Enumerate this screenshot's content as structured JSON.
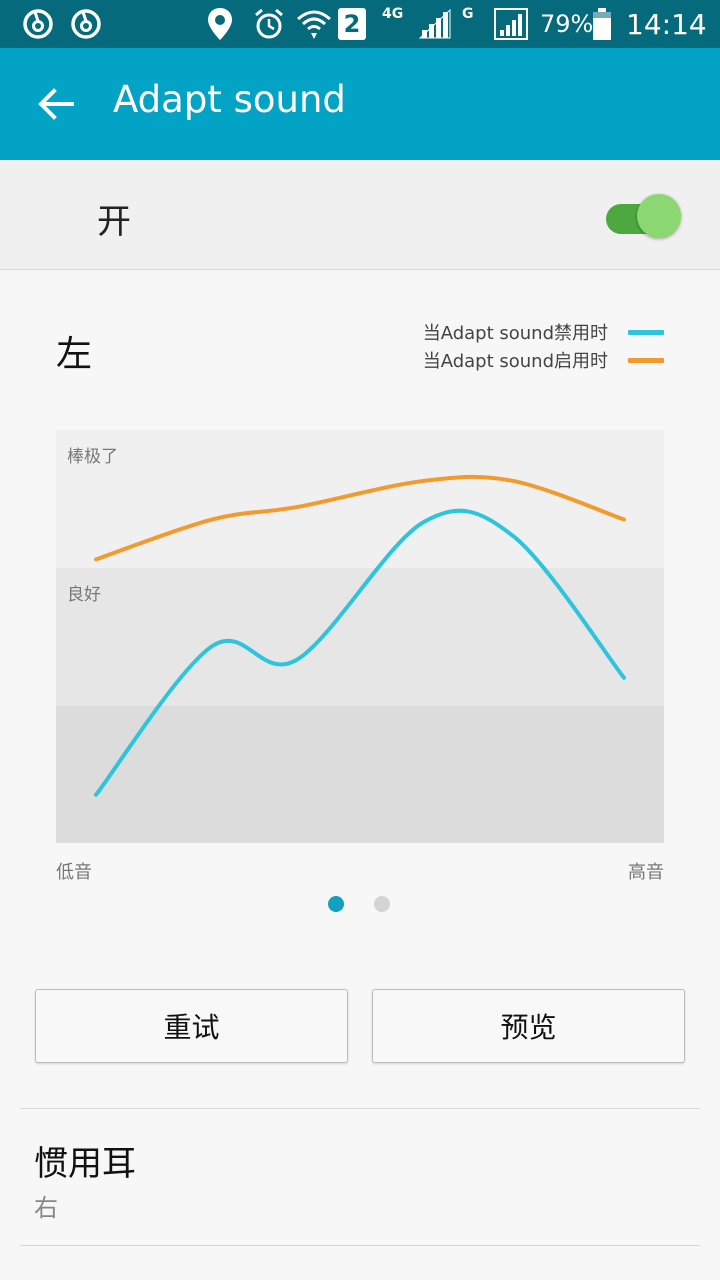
{
  "status_bar": {
    "network_type": "4G",
    "network_type_2": "G",
    "sim_slot": "2",
    "battery_percent": "79%",
    "time": "14:14",
    "icons": [
      "netease-music-icon",
      "netease-music-icon",
      "location-icon",
      "alarm-icon",
      "wifi-icon",
      "sim-2-icon",
      "signal-icon",
      "signal-icon",
      "battery-icon"
    ]
  },
  "app_bar": {
    "title": "Adapt sound",
    "back_icon": "arrow-left-icon"
  },
  "toggle": {
    "label": "开",
    "state": "on",
    "track_color": "#4da83f",
    "thumb_color": "#8bd771"
  },
  "chart_section": {
    "side_label": "左",
    "legend": [
      {
        "label": "当Adapt sound禁用时",
        "color": "#2ec4dc"
      },
      {
        "label": "当Adapt sound启用时",
        "color": "#f29a2e"
      }
    ],
    "bands": [
      {
        "label": "棒极了",
        "color": "#f0f0f0"
      },
      {
        "label": "良好",
        "color": "#e6e6e6"
      },
      {
        "label": "",
        "color": "#dcdcdc"
      }
    ],
    "x_axis": {
      "left_label": "低音",
      "right_label": "高音"
    }
  },
  "chart_data": {
    "type": "line",
    "y_scale": "normalized 0 (bottom) to 3 (top), bands: 0-1 unlabeled, 1-2 良好, 2-3 棒极了",
    "ylim": [
      0,
      3
    ],
    "series": [
      {
        "name": "当Adapt sound禁用时",
        "color": "#2ec4dc",
        "values": [
          0.35,
          1.43,
          1.33,
          2.33,
          2.23,
          1.2
        ]
      },
      {
        "name": "当Adapt sound启用时",
        "color": "#f29a2e",
        "values": [
          2.06,
          2.35,
          2.44,
          2.63,
          2.63,
          2.35
        ]
      }
    ],
    "x": [
      0,
      0.22,
      0.38,
      0.62,
      0.79,
      1.0
    ]
  },
  "pager": {
    "pages": 2,
    "active_index": 0,
    "active_color": "#14a0c0",
    "inactive_color": "#d4d4d4"
  },
  "buttons": {
    "retry": "重试",
    "preview": "预览"
  },
  "preference": {
    "title": "惯用耳",
    "value": "右"
  }
}
